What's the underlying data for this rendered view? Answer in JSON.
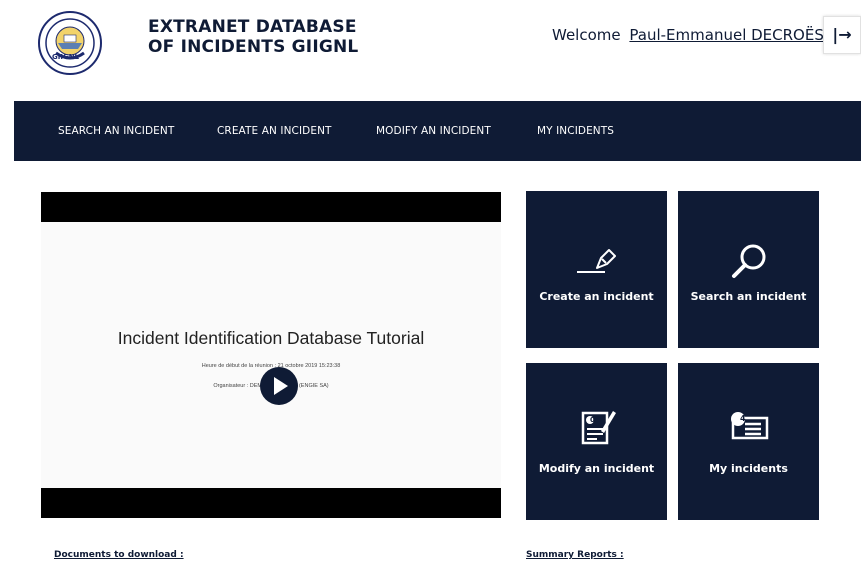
{
  "header": {
    "brand_line1": "EXTRANET DATABASE",
    "brand_line2": "OF INCIDENTS GIIGNL",
    "logo_text": "GIIGNL",
    "welcome_label": "Welcome",
    "user_name": "Paul-Emmanuel DECROËS",
    "logout_icon": "logout-icon",
    "logout_glyph": "|→"
  },
  "nav": {
    "items": [
      {
        "label": "SEARCH AN INCIDENT"
      },
      {
        "label": "CREATE AN INCIDENT"
      },
      {
        "label": "MODIFY AN INCIDENT"
      },
      {
        "label": "MY INCIDENTS"
      }
    ]
  },
  "video": {
    "title": "Incident Identification Database Tutorial",
    "subtitle_line1": "Heure de début de la réunion : 21 octobre 2019 15:23:38",
    "subtitle_line2": "Organisateur : DEMOURY Vincent (ENGIE SA)"
  },
  "tiles": [
    {
      "label": "Create an incident",
      "icon": "pen-icon"
    },
    {
      "label": "Search an incident",
      "icon": "magnifier-icon"
    },
    {
      "label": "Modify an incident",
      "icon": "edit-document-icon"
    },
    {
      "label": "My incidents",
      "icon": "badge-list-icon"
    }
  ],
  "badge_number": "4",
  "modify_number": "0",
  "sections": {
    "documents": "Documents to download :",
    "summary": "Summary Reports :"
  },
  "colors": {
    "navy": "#0f1b35",
    "white": "#ffffff"
  }
}
